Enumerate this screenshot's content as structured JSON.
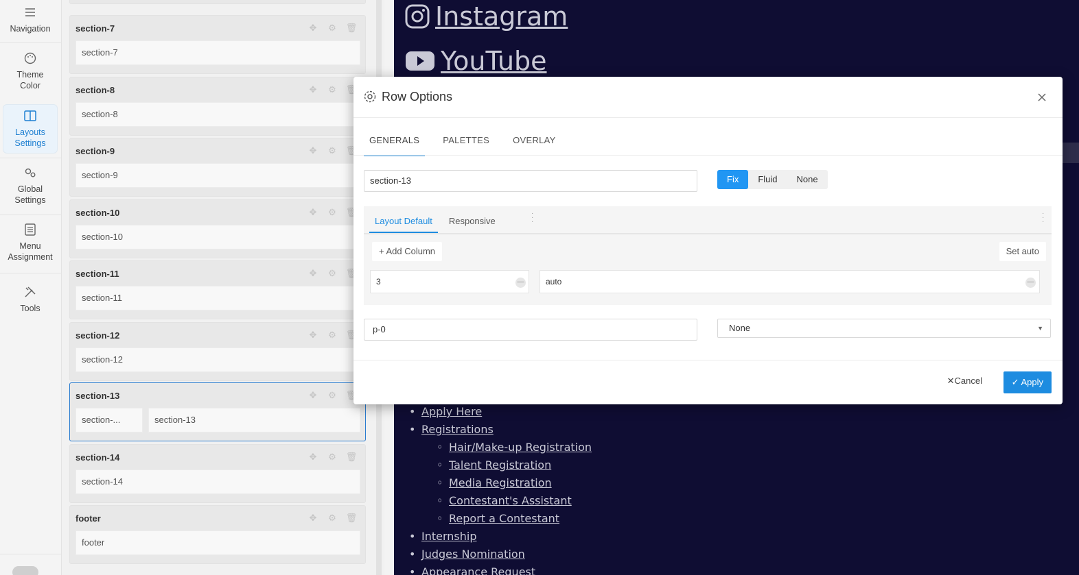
{
  "nav": {
    "items": [
      {
        "label": "Navigation",
        "icon": "menu-icon"
      },
      {
        "label": "Theme Color",
        "icon": "palette-icon"
      },
      {
        "label": "Layouts Settings",
        "icon": "layout-icon"
      },
      {
        "label": "Global Settings",
        "icon": "gears-icon"
      },
      {
        "label": "Menu Assignment",
        "icon": "list-icon"
      },
      {
        "label": "Tools",
        "icon": "tools-icon"
      }
    ],
    "active": "Layouts Settings"
  },
  "sections": [
    {
      "title": "section-7",
      "cols": [
        "section-7"
      ]
    },
    {
      "title": "section-8",
      "cols": [
        "section-8"
      ]
    },
    {
      "title": "section-9",
      "cols": [
        "section-9"
      ]
    },
    {
      "title": "section-10",
      "cols": [
        "section-10"
      ]
    },
    {
      "title": "section-11",
      "cols": [
        "section-11"
      ]
    },
    {
      "title": "section-12",
      "cols": [
        "section-12"
      ]
    },
    {
      "title": "section-13",
      "cols": [
        "section-...",
        "section-13"
      ]
    },
    {
      "title": "section-14",
      "cols": [
        "section-14"
      ]
    },
    {
      "title": "footer",
      "cols": [
        "footer"
      ]
    }
  ],
  "preview": {
    "social": [
      {
        "label": "Instagram",
        "icon": "instagram-icon"
      },
      {
        "label": "YouTube",
        "icon": "youtube-icon"
      }
    ],
    "menu": [
      {
        "label": "Apply Here",
        "level": 1
      },
      {
        "label": "Registrations",
        "level": 1
      },
      {
        "label": "Hair/Make-up Registration",
        "level": 2
      },
      {
        "label": "Talent Registration",
        "level": 2
      },
      {
        "label": "Media Registration",
        "level": 2
      },
      {
        "label": "Contestant's Assistant",
        "level": 2
      },
      {
        "label": "Report a Contestant",
        "level": 2
      },
      {
        "label": "Internship",
        "level": 1
      },
      {
        "label": "Judges Nomination",
        "level": 1
      },
      {
        "label": "Appearance Request",
        "level": 1
      }
    ]
  },
  "modal": {
    "title": "Row Options",
    "tabs": [
      "GENERALS",
      "PALETTES",
      "OVERLAY"
    ],
    "active_tab": "GENERALS",
    "row_name": "section-13",
    "container_options": [
      "Fix",
      "Fluid",
      "None"
    ],
    "container_selected": "Fix",
    "layout_tabs": [
      "Layout Default",
      "Responsive"
    ],
    "add_column_label": "Add Column",
    "set_auto_label": "Set auto",
    "columns": [
      "3",
      "auto"
    ],
    "row_class": "p-0",
    "select_value": "None",
    "cancel_label": "Cancel",
    "apply_label": "Apply"
  },
  "colors": {
    "accent": "#1d8ce0",
    "preview_bg": "#0f0d33",
    "selected_border": "#2a7ccf"
  }
}
